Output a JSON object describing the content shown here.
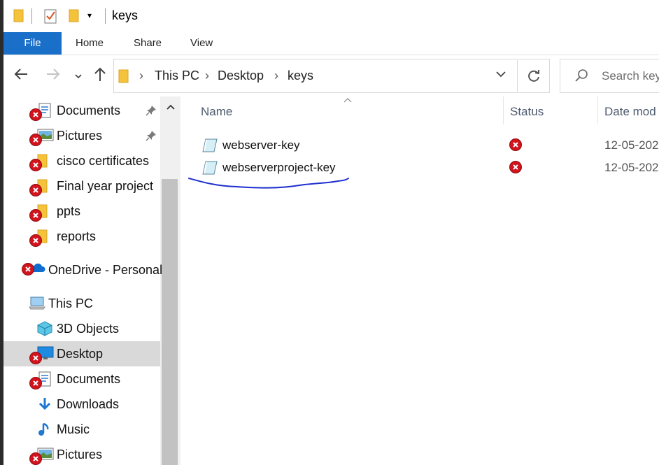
{
  "window": {
    "title": "keys"
  },
  "ribbon": {
    "tabs": [
      "File",
      "Home",
      "Share",
      "View"
    ]
  },
  "navigation": {
    "breadcrumb": [
      "This PC",
      "Desktop",
      "keys"
    ],
    "search_placeholder": "Search keys"
  },
  "sidebar": {
    "items": [
      {
        "label": "Documents",
        "icon": "documents-icon",
        "error": true,
        "pinned": true
      },
      {
        "label": "Pictures",
        "icon": "pictures-icon",
        "error": true,
        "pinned": true
      },
      {
        "label": "cisco certificates",
        "icon": "folder-icon",
        "error": true,
        "pinned": false
      },
      {
        "label": "Final year project",
        "icon": "folder-icon",
        "error": true,
        "pinned": false
      },
      {
        "label": "ppts",
        "icon": "folder-icon",
        "error": true,
        "pinned": false
      },
      {
        "label": "reports",
        "icon": "folder-icon",
        "error": true,
        "pinned": false
      },
      {
        "label": "OneDrive - Personal",
        "icon": "onedrive-icon",
        "error": true,
        "pinned": false
      },
      {
        "label": "This PC",
        "icon": "this-pc-icon",
        "error": false,
        "pinned": false
      },
      {
        "label": "3D Objects",
        "icon": "3d-objects-icon",
        "error": false,
        "pinned": false
      },
      {
        "label": "Desktop",
        "icon": "desktop-icon",
        "error": true,
        "pinned": false,
        "selected": true
      },
      {
        "label": "Documents",
        "icon": "documents-icon",
        "error": true,
        "pinned": false
      },
      {
        "label": "Downloads",
        "icon": "downloads-icon",
        "error": false,
        "pinned": false
      },
      {
        "label": "Music",
        "icon": "music-icon",
        "error": false,
        "pinned": false
      },
      {
        "label": "Pictures",
        "icon": "pictures-icon",
        "error": true,
        "pinned": false
      }
    ]
  },
  "file_list": {
    "columns": [
      "Name",
      "Status",
      "Date mod"
    ],
    "rows": [
      {
        "name": "webserver-key",
        "status": "sync-error",
        "date": "12-05-202"
      },
      {
        "name": "webserverproject-key",
        "status": "sync-error",
        "date": "12-05-202"
      }
    ]
  },
  "colors": {
    "accent": "#1a6fc9",
    "error": "#d1141d",
    "annotation": "#1f2fcf",
    "selection": "#d9d9d9"
  }
}
